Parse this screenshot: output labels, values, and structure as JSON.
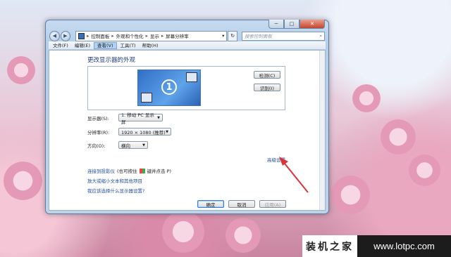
{
  "window": {
    "breadcrumb": [
      "控制面板",
      "外观和个性化",
      "显示",
      "屏幕分辨率"
    ],
    "search_placeholder": "搜索控制面板",
    "caption": {
      "minimize": "─",
      "maximize": "□",
      "close": "✕"
    }
  },
  "menubar": {
    "items": [
      {
        "label": "文件(F)",
        "active": false
      },
      {
        "label": "编辑(E)",
        "active": false
      },
      {
        "label": "查看(V)",
        "active": true
      },
      {
        "label": "工具(T)",
        "active": false
      },
      {
        "label": "帮助(H)",
        "active": false
      }
    ]
  },
  "content": {
    "title": "更改显示器的外观",
    "monitor_number": "1",
    "detect_label": "检测(C)",
    "identify_label": "识别(I)",
    "display": {
      "label": "显示器(S):",
      "value": "1. 移动 PC 显示屏"
    },
    "resolution": {
      "label": "分辨率(R):",
      "value": "1920 × 1080 (推荐)"
    },
    "orientation": {
      "label": "方向(O):",
      "value": "横向"
    },
    "advanced_link": "高级设置",
    "links": {
      "projector": "连接到投影仪",
      "projector_hint": "(也可按住",
      "projector_hint2": "键并点击 P)",
      "text_size": "放大或缩小文本和其他项目",
      "which_setting": "我应该选择什么显示器设置?"
    }
  },
  "buttons": {
    "ok": "确定",
    "cancel": "取消",
    "apply": "应用(A)"
  },
  "watermark": {
    "left": "装机之家",
    "right": "www.lotpc.com"
  },
  "colors": {
    "link": "#1f4fa0",
    "title": "#1e3a8a",
    "arrow": "#d7353a"
  }
}
